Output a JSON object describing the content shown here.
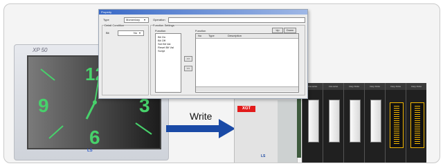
{
  "hmi": {
    "model": "XP 50",
    "brand": "LS",
    "clock_numbers": {
      "twelve": "12",
      "three": "3",
      "six": "6",
      "nine": "9"
    }
  },
  "transfer": {
    "label": "Write"
  },
  "plc": {
    "cpu_logo": "XGT",
    "cpu_brand": "LS",
    "modules": [
      "XGI-A21A",
      "XGI-A21A",
      "XGQ-TR4A",
      "XGQ-TR4A",
      "XGQ-TR4A",
      "XGQ-TR4A"
    ]
  },
  "dialog": {
    "title": "Property",
    "type_label": "Type",
    "type_value": "Momentary",
    "operation_label": "Operation",
    "detail_label": "Detail Condition",
    "bit_label": "Bit",
    "bit_value": "No",
    "function_settings_label": "Function Settings",
    "function_list_label": "Function",
    "function_list": [
      "Bit On",
      "Bit Off",
      "Set Bit Val",
      "Reset Bit Val",
      "Script"
    ],
    "add_button": ">>",
    "remove_button": "<<",
    "functions_label": "Function",
    "up_button": "Up",
    "down_button": "Down",
    "columns": [
      "No",
      "Type",
      "Description"
    ]
  },
  "colors": {
    "clock_digits": "#47d16b",
    "arrow": "#1a4aa6",
    "cpu_logo": "#e21b1b"
  }
}
